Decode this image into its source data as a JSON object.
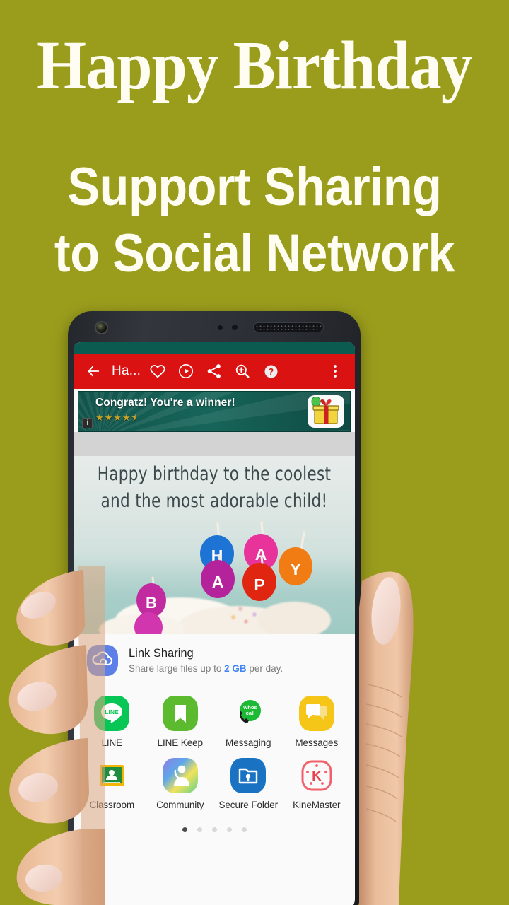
{
  "promo": {
    "title": "Happy Birthday",
    "subtitle_line1": "Support Sharing",
    "subtitle_line2": "to Social Network",
    "background_color": "#9A9D1C",
    "text_color": "#FFFDF2"
  },
  "phone": {
    "status_bar_color": "#0C5B51",
    "appbar": {
      "color": "#DA1212",
      "title": "Ha...",
      "back_label": "Back",
      "favorite_label": "Favorite",
      "play_label": "Play",
      "share_label": "Share",
      "zoom_label": "Zoom in",
      "help_label": "Help",
      "overflow_label": "More options"
    },
    "ad": {
      "headline": "Congratz! You're a winner!",
      "stars": "★★★★⯨",
      "info_glyph": "i",
      "background_color": "#11544B"
    },
    "card": {
      "line1": "Happy birthday to the coolest",
      "line2": "and the most adorable child!",
      "candles": [
        {
          "letter": "B",
          "color": "#C22BA0"
        },
        {
          "letter": "H",
          "color": "#1E74D4"
        },
        {
          "letter": "A",
          "color": "#B4239B"
        },
        {
          "letter": "A",
          "color": "#E8339B"
        },
        {
          "letter": "P",
          "color": "#E02610"
        },
        {
          "letter": "Y",
          "color": "#F07C13"
        }
      ]
    },
    "link_sharing": {
      "title": "Link Sharing",
      "subtitle_before": "Share large files up to ",
      "subtitle_highlight": "2 GB",
      "subtitle_after": " per day.",
      "highlight_color": "#4285F4",
      "icon_color": "#5C7FE8"
    },
    "share_targets": [
      {
        "label": "LINE",
        "icon": "line-icon",
        "color": "#06C755"
      },
      {
        "label": "LINE Keep",
        "icon": "line-keep-icon",
        "color": "#5BBA2E"
      },
      {
        "label": "Messaging",
        "icon": "whoscall-icon",
        "color": "#1BB934"
      },
      {
        "label": "Messages",
        "icon": "messages-icon",
        "color": "#F5C518"
      },
      {
        "label": "Classroom",
        "icon": "classroom-icon",
        "color": "#1E8E3E"
      },
      {
        "label": "Community",
        "icon": "community-icon",
        "color": "#7FD1E0"
      },
      {
        "label": "Secure Folder",
        "icon": "secure-folder-icon",
        "color": "#1A73C2"
      },
      {
        "label": "KineMaster",
        "icon": "kinemaster-icon",
        "color": "#F2616B"
      }
    ],
    "pager": {
      "count": 5,
      "active_index": 0
    }
  }
}
